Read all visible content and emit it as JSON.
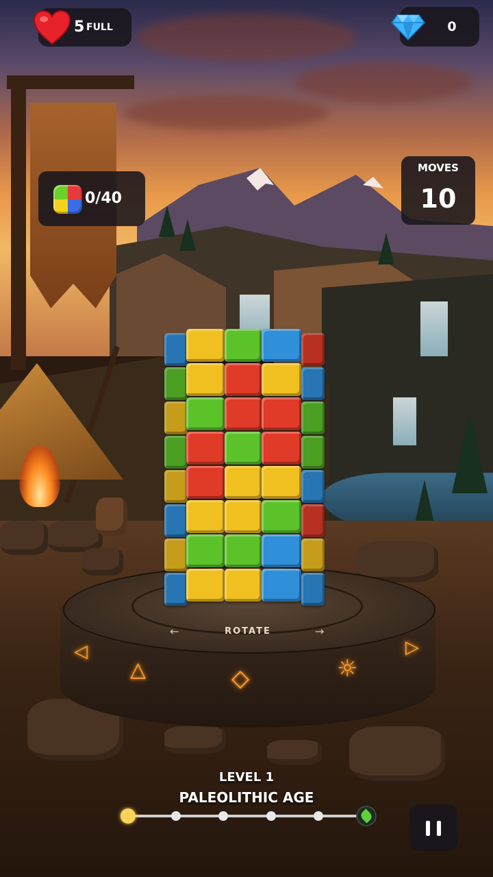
{
  "hud": {
    "lives": {
      "count": "5",
      "status": "FULL",
      "icon": "heart-icon",
      "color": "#e8222a"
    },
    "gems": {
      "count": "0",
      "icon": "diamond-icon",
      "color": "#39b6ff"
    },
    "goal": {
      "text": "0/40",
      "icon": "multicolor-block-icon"
    },
    "moves": {
      "label": "MOVES",
      "value": "10"
    }
  },
  "pedestal": {
    "rotate_label": "ROTATE"
  },
  "level": {
    "label": "LEVEL 1",
    "age": "PALEOLITHIC AGE",
    "progress_stage": 0,
    "progress_stops": 6
  },
  "controls": {
    "pause_icon": "pause-icon"
  },
  "block_colors": {
    "B": "#2f8fd9",
    "Y": "#f0c020",
    "G": "#5cc22a",
    "R": "#e03a28"
  },
  "tower_grid": [
    [
      "B",
      "Y",
      "G",
      "B",
      "R"
    ],
    [
      "G",
      "Y",
      "R",
      "Y",
      "B"
    ],
    [
      "Y",
      "G",
      "R",
      "R",
      "G"
    ],
    [
      "G",
      "R",
      "G",
      "R",
      "G"
    ],
    [
      "Y",
      "R",
      "Y",
      "Y",
      "B"
    ],
    [
      "B",
      "Y",
      "Y",
      "G",
      "R"
    ],
    [
      "Y",
      "G",
      "G",
      "B",
      "Y"
    ],
    [
      "B",
      "Y",
      "Y",
      "B",
      "B"
    ]
  ]
}
